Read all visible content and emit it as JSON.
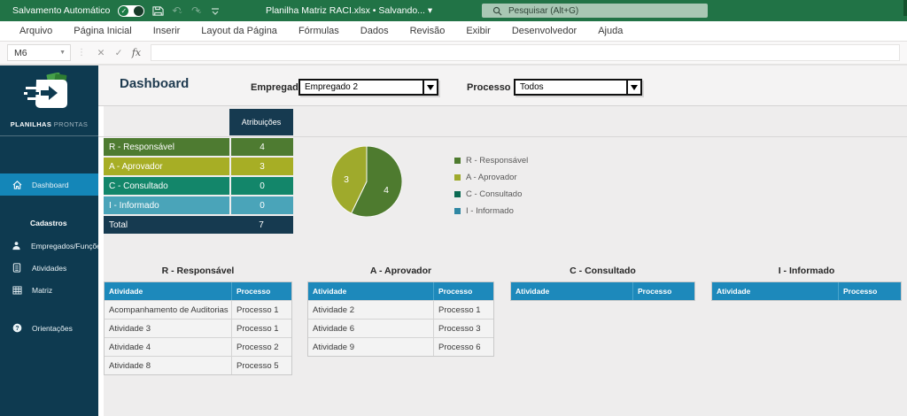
{
  "titlebar": {
    "autosave_label": "Salvamento Automático",
    "document_title": "Planilha Matriz RACI.xlsx • Salvando...",
    "title_caret": "▾",
    "search_placeholder": "Pesquisar (Alt+G)",
    "check": "✓",
    "undo": "↶",
    "redo": "↷",
    "brand_green": "#217346"
  },
  "ribbon": {
    "tabs": [
      "Arquivo",
      "Página Inicial",
      "Inserir",
      "Layout da Página",
      "Fórmulas",
      "Dados",
      "Revisão",
      "Exibir",
      "Desenvolvedor",
      "Ajuda"
    ]
  },
  "formula_bar": {
    "name_box": "M6",
    "cancel": "✕",
    "enter": "✓",
    "fx": "fx",
    "formula_value": ""
  },
  "sidebar": {
    "logo_word1": "PLANILHAS",
    "logo_word2": " PRONTAS",
    "dashboard_item": "Dashboard",
    "section_label": "Cadastros",
    "items": [
      {
        "label": "Empregados/Funções",
        "icon": "person-icon"
      },
      {
        "label": "Atividades",
        "icon": "clipboard-icon"
      },
      {
        "label": "Matriz",
        "icon": "grid-icon"
      }
    ],
    "help_item": "Orientações",
    "bg": "#0e3a50",
    "active_bg": "#1486b8"
  },
  "dashboard": {
    "title": "Dashboard",
    "filters": [
      {
        "label": "Empregado",
        "value": "Empregado 2"
      },
      {
        "label": "Processo",
        "value": "Todos"
      }
    ]
  },
  "summary": {
    "header": "Atribuições",
    "rows": [
      {
        "label": "R - Responsável",
        "value": "4",
        "color": "#4e7b31"
      },
      {
        "label": "A - Aprovador",
        "value": "3",
        "color": "#a7ae25"
      },
      {
        "label": "C - Consultado",
        "value": "0",
        "color": "#13866a"
      },
      {
        "label": "I - Informado",
        "value": "0",
        "color": "#4aa4b9"
      }
    ],
    "total_label": "Total",
    "total_value": "7",
    "total_color": "#163a50"
  },
  "chart_data": {
    "type": "pie",
    "title": "",
    "legend_position": "right",
    "slices": [
      {
        "label": "R - Responsável",
        "value": 4,
        "color": "#4e7b2f"
      },
      {
        "label": "A - Aprovador",
        "value": 3,
        "color": "#9faa2c"
      },
      {
        "label": "C - Consultado",
        "value": 0,
        "color": "#0b6a52"
      },
      {
        "label": "I - Informado",
        "value": 0,
        "color": "#2f87a3"
      }
    ]
  },
  "bottom_tables": [
    {
      "title": "R - Responsável",
      "columns": [
        "Atividade",
        "Processo"
      ],
      "rows": [
        [
          "Acompanhamento de Auditorias",
          "Processo 1"
        ],
        [
          "Atividade 3",
          "Processo 1"
        ],
        [
          "Atividade 4",
          "Processo 2"
        ],
        [
          "Atividade 8",
          "Processo 5"
        ]
      ]
    },
    {
      "title": "A - Aprovador",
      "columns": [
        "Atividade",
        "Processo"
      ],
      "rows": [
        [
          "Atividade 2",
          "Processo 1"
        ],
        [
          "Atividade 6",
          "Processo 3"
        ],
        [
          "Atividade 9",
          "Processo 6"
        ]
      ]
    },
    {
      "title": "C - Consultado",
      "columns": [
        "Atividade",
        "Processo"
      ],
      "rows": []
    },
    {
      "title": "I - Informado",
      "columns": [
        "Atividade",
        "Processo"
      ],
      "rows": []
    }
  ]
}
